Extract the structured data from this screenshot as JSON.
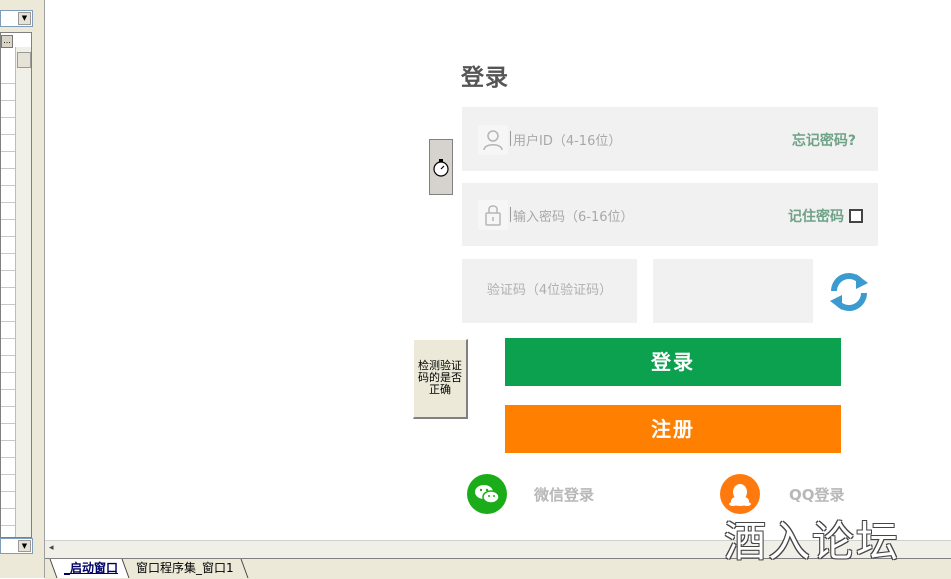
{
  "form": {
    "title": "登录",
    "username_placeholder": "用户ID（4-16位）",
    "forgot_password": "忘记密码?",
    "password_placeholder": "输入密码（6-16位）",
    "remember_password": "记住密码",
    "captcha_placeholder": "验证码（4位验证码）",
    "check_button": "检测验证码的是否正确",
    "login_button": "登录",
    "register_button": "注册",
    "wechat_login": "微信登录",
    "qq_login": "QQ登录"
  },
  "tabs": [
    {
      "label": "_启动窗口",
      "active": true
    },
    {
      "label": "窗口程序集_窗口1",
      "active": false
    }
  ],
  "left_panel": {
    "ellipsis": "..."
  },
  "watermark": "酒入论坛",
  "colors": {
    "login_green": "#0ca14f",
    "register_orange": "#ff8000",
    "link_green": "#6fa287",
    "refresh_blue": "#3b9ad0",
    "wechat_green": "#1aad19",
    "qq_orange": "#ff7a0e"
  },
  "icons": {
    "username": "user-icon",
    "password": "lock-icon",
    "refresh": "refresh-icon",
    "stopwatch": "stopwatch-icon",
    "wechat": "wechat-icon",
    "qq": "qq-icon"
  }
}
